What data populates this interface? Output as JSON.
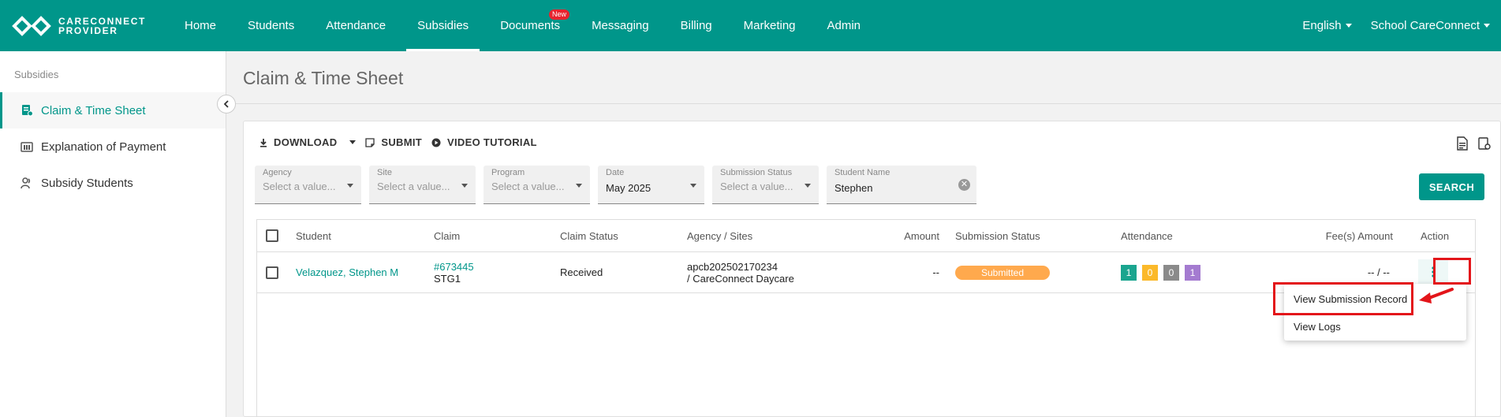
{
  "brand": {
    "line1": "CARECONNECT",
    "line2": "PROVIDER"
  },
  "nav": {
    "items": [
      {
        "label": "Home"
      },
      {
        "label": "Students"
      },
      {
        "label": "Attendance"
      },
      {
        "label": "Subsidies",
        "active": true
      },
      {
        "label": "Documents",
        "badge": "New"
      },
      {
        "label": "Messaging"
      },
      {
        "label": "Billing"
      },
      {
        "label": "Marketing"
      },
      {
        "label": "Admin"
      }
    ],
    "language": "English",
    "school": "School CareConnect"
  },
  "sidebar": {
    "heading": "Subsidies",
    "items": [
      {
        "label": "Claim & Time Sheet",
        "icon": "claim-icon",
        "active": true
      },
      {
        "label": "Explanation of Payment",
        "icon": "bank-icon"
      },
      {
        "label": "Subsidy Students",
        "icon": "students-icon"
      }
    ]
  },
  "page": {
    "title": "Claim & Time Sheet"
  },
  "toolbar": {
    "download": "DOWNLOAD",
    "submit": "SUBMIT",
    "video": "VIDEO TUTORIAL"
  },
  "filters": {
    "agency": {
      "label": "Agency",
      "placeholder": "Select a value..."
    },
    "site": {
      "label": "Site",
      "placeholder": "Select a value..."
    },
    "program": {
      "label": "Program",
      "placeholder": "Select a value..."
    },
    "date": {
      "label": "Date",
      "value": "May 2025"
    },
    "submission_status": {
      "label": "Submission Status",
      "placeholder": "Select a value..."
    },
    "student_name": {
      "label": "Student Name",
      "value": "Stephen"
    }
  },
  "search_label": "SEARCH",
  "table": {
    "headers": {
      "student": "Student",
      "claim": "Claim",
      "claim_status": "Claim Status",
      "agency": "Agency / Sites",
      "amount": "Amount",
      "submission_status": "Submission Status",
      "attendance": "Attendance",
      "fees": "Fee(s) Amount",
      "action": "Action"
    },
    "rows": [
      {
        "student": "Velazquez, Stephen M",
        "claim_id": "#673445",
        "claim_code": "STG1",
        "claim_status": "Received",
        "agency_line1": "apcb202502170234",
        "agency_line2": "/ CareConnect Daycare",
        "amount": "--",
        "submission_status": "Submitted",
        "attendance": [
          "1",
          "0",
          "0",
          "1"
        ],
        "fees": "-- / --"
      }
    ]
  },
  "action_menu": {
    "items": [
      "View Submission Record",
      "View Logs"
    ]
  },
  "colors": {
    "primary": "#00968a",
    "submitted": "#ffa94d",
    "att_green": "#1aa58f",
    "att_orange": "#fbb92a",
    "att_gray": "#8a8a8a",
    "att_purple": "#a47bd0",
    "highlight": "#e3151a"
  }
}
